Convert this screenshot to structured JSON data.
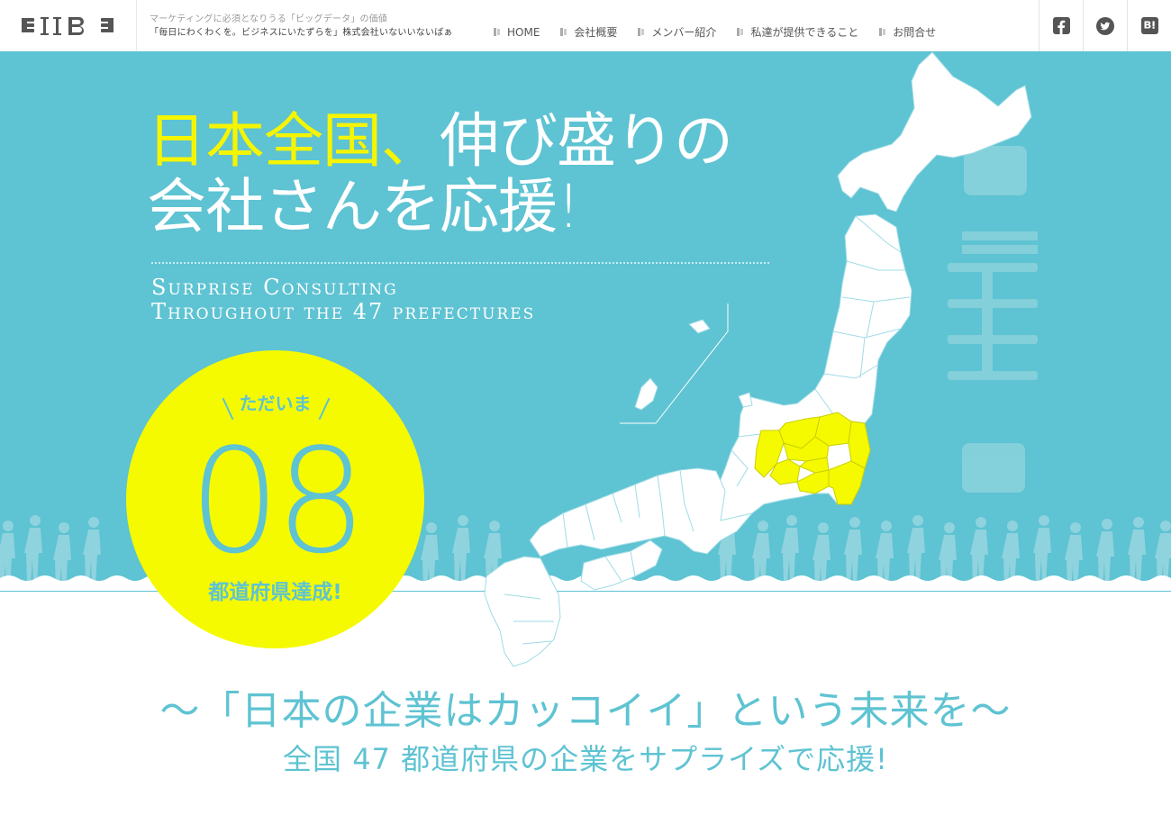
{
  "header": {
    "logo_text": "IIB",
    "tagline_1": "マーケティングに必須となりうる「ビッグデータ」の価値",
    "tagline_2": "「毎日にわくわくを。ビジネスにいたずらを」株式会社いないいないばぁ",
    "nav": [
      "HOME",
      "会社概要",
      "メンバー紹介",
      "私達が提供できること",
      "お問合せ"
    ],
    "social": [
      "facebook-icon",
      "twitter-icon",
      "hatena-bookmark-icon"
    ]
  },
  "hero": {
    "headline_hl": "日本全国、",
    "headline_rest": "伸び盛りの",
    "headline_row2": "会社さんを応援!",
    "sub_en_1": "Surprise Consulting",
    "sub_en_2": "Throughout the 47 prefectures",
    "badge_top": "ただいま",
    "badge_number": "08",
    "badge_bottom": "都道府県達成!"
  },
  "message": {
    "line1": "〜「日本の企業はカッコイイ」という未来を〜",
    "line2": "全国 47 都道府県の企業をサプライズで応援!"
  },
  "colors": {
    "accent": "#5ec3d2",
    "highlight": "#f5fa00"
  }
}
